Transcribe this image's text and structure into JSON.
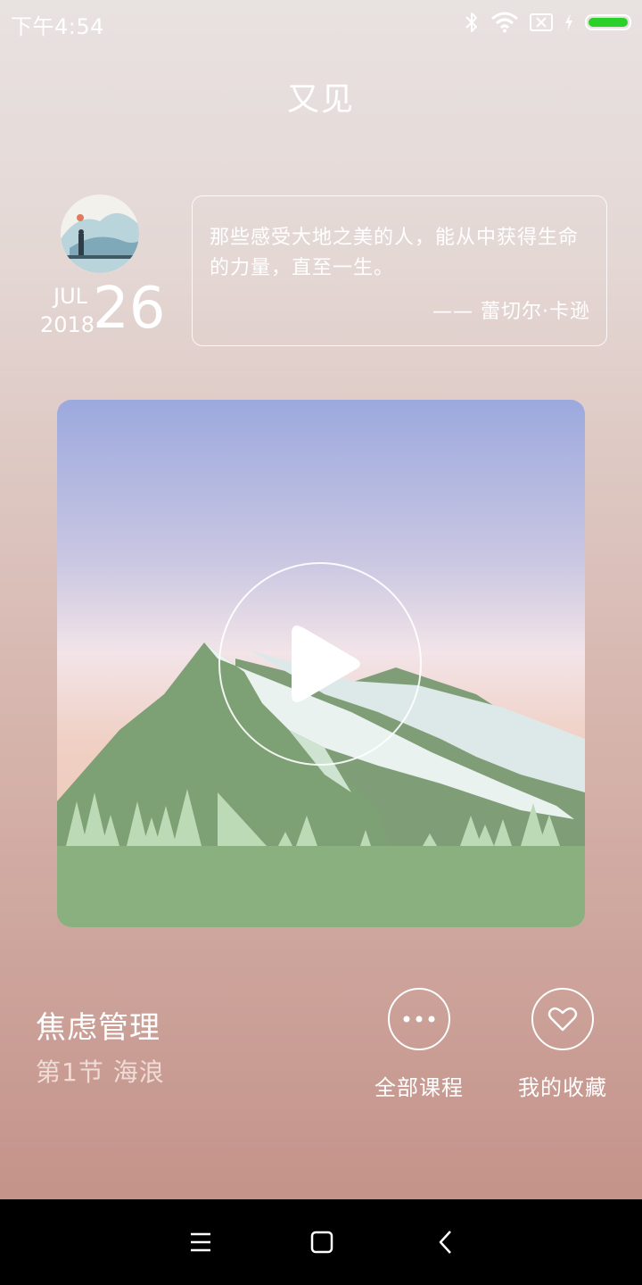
{
  "status_bar": {
    "time": "下午4:54",
    "icons": [
      "bluetooth-icon",
      "wifi-icon",
      "sim-off-icon",
      "charging-icon",
      "battery-icon"
    ],
    "battery_color": "#29d12a"
  },
  "header": {
    "title": "又见"
  },
  "daily": {
    "date": {
      "month": "JUL",
      "year": "2018",
      "day": "26"
    },
    "quote": {
      "text": "那些感受大地之美的人，能从中获得生命的力量，直至一生。",
      "author": "—— 蕾切尔·卡逊"
    }
  },
  "player": {
    "icon": "play-icon"
  },
  "course": {
    "title": "焦虑管理",
    "lesson": "第1节 海浪"
  },
  "actions": {
    "all_courses": {
      "label": "全部课程",
      "icon": "more-icon"
    },
    "favorites": {
      "label": "我的收藏",
      "icon": "heart-icon"
    }
  },
  "navigation": {
    "icons": [
      "menu-icon",
      "home-icon",
      "back-icon"
    ]
  }
}
